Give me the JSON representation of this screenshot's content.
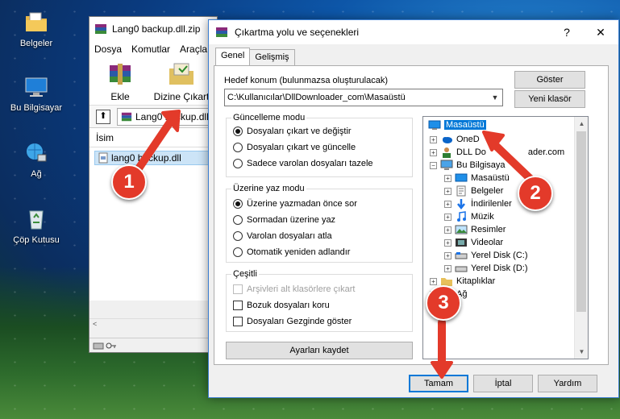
{
  "desktop": {
    "icons": [
      {
        "label": "Belgeler"
      },
      {
        "label": "Bu Bilgisayar"
      },
      {
        "label": "Ağ"
      },
      {
        "label": "Çöp Kutusu"
      }
    ]
  },
  "bg_window": {
    "title": "Lang0 backup.dll.zip",
    "menu": [
      "Dosya",
      "Komutlar",
      "Araçla"
    ],
    "toolbar": {
      "add_label": "Ekle",
      "extract_label": "Dizine Çıkart"
    },
    "address": "Lang0 backup.dll",
    "list_header": "İsim",
    "file": "lang0 backup.dll"
  },
  "dialog": {
    "title": "Çıkartma yolu ve seçenekleri",
    "help_glyph": "?",
    "close_glyph": "✕",
    "tabs": [
      "Genel",
      "Gelişmiş"
    ],
    "dest_label": "Hedef konum (bulunmazsa oluşturulacak)",
    "dest_value": "C:\\Kullanıcılar\\DllDownloader_com\\Masaüstü",
    "show_button": "Göster",
    "new_folder_button": "Yeni klasör",
    "update_mode": {
      "title": "Güncelleme modu",
      "options": [
        "Dosyaları çıkart ve değiştir",
        "Dosyaları çıkart ve güncelle",
        "Sadece varolan dosyaları tazele"
      ],
      "selected": 0
    },
    "overwrite_mode": {
      "title": "Üzerine yaz modu",
      "options": [
        "Üzerine yazmadan önce sor",
        "Sormadan üzerine yaz",
        "Varolan dosyaları atla",
        "Otomatik yeniden adlandır"
      ],
      "selected": 0
    },
    "misc": {
      "title": "Çeşitli",
      "options": [
        "Arşivleri alt klasörlere çıkart",
        "Bozuk dosyaları koru",
        "Dosyaları Gezginde göster"
      ],
      "disabled": [
        true,
        false,
        false
      ],
      "checked": [
        false,
        false,
        false
      ]
    },
    "save_settings_button": "Ayarları kaydet",
    "tree": {
      "root": "Masaüstü",
      "level1": [
        "OneD",
        "DLL Do",
        "Bu Bilgisaya"
      ],
      "level1_suffix": [
        "",
        "ader.com",
        ""
      ],
      "pc_children": [
        "Masaüstü",
        "Belgeler",
        "İndirilenler",
        "Müzik",
        "Resimler",
        "Videolar",
        "Yerel Disk (C:)",
        "Yerel Disk (D:)"
      ],
      "bottom": [
        "Kitaplıklar",
        "Ağ"
      ]
    },
    "ok_button": "Tamam",
    "cancel_button": "İptal",
    "help_button": "Yardım"
  },
  "annotations": {
    "markers": [
      "1",
      "2",
      "3"
    ],
    "color": "#e33a2a"
  }
}
